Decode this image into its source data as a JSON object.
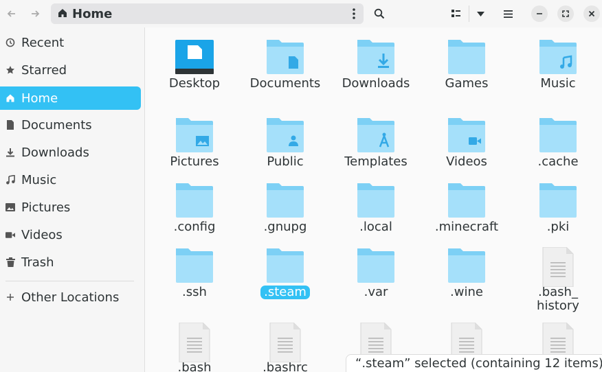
{
  "header": {
    "location_title": "Home"
  },
  "sidebar": {
    "items": [
      {
        "label": "Recent",
        "icon": "clock-icon"
      },
      {
        "label": "Starred",
        "icon": "star-icon"
      },
      {
        "label": "Home",
        "icon": "home-icon",
        "active": true
      },
      {
        "label": "Documents",
        "icon": "document-icon"
      },
      {
        "label": "Downloads",
        "icon": "download-icon"
      },
      {
        "label": "Music",
        "icon": "music-icon"
      },
      {
        "label": "Pictures",
        "icon": "picture-icon"
      },
      {
        "label": "Videos",
        "icon": "video-icon"
      },
      {
        "label": "Trash",
        "icon": "trash-icon"
      }
    ],
    "other_locations": "Other Locations"
  },
  "files": [
    {
      "label": "Desktop",
      "type": "desktop"
    },
    {
      "label": "Documents",
      "type": "folder-documents"
    },
    {
      "label": "Downloads",
      "type": "folder-downloads"
    },
    {
      "label": "Games",
      "type": "folder"
    },
    {
      "label": "Music",
      "type": "folder-music"
    },
    {
      "label": "Pictures",
      "type": "folder-pictures"
    },
    {
      "label": "Public",
      "type": "folder-public"
    },
    {
      "label": "Templates",
      "type": "folder-templates"
    },
    {
      "label": "Videos",
      "type": "folder-videos"
    },
    {
      "label": ".cache",
      "type": "folder"
    },
    {
      "label": ".config",
      "type": "folder"
    },
    {
      "label": ".gnupg",
      "type": "folder"
    },
    {
      "label": ".local",
      "type": "folder"
    },
    {
      "label": ".minecraft",
      "type": "folder"
    },
    {
      "label": ".pki",
      "type": "folder"
    },
    {
      "label": ".ssh",
      "type": "folder"
    },
    {
      "label": ".steam",
      "type": "folder",
      "selected": true
    },
    {
      "label": ".var",
      "type": "folder"
    },
    {
      "label": ".wine",
      "type": "folder"
    },
    {
      "label": ".bash_\nhistory",
      "type": "text-file"
    },
    {
      "label": ".bash",
      "type": "text-file"
    },
    {
      "label": ".bashrc",
      "type": "text-file"
    },
    {
      "label": "",
      "type": "text-file"
    },
    {
      "label": "",
      "type": "text-file"
    },
    {
      "label": "",
      "type": "text-file"
    }
  ],
  "status": "“.steam” selected  (containing 12 items)",
  "colors": {
    "accent": "#33c1f4",
    "folder_back": "#7dd0f5",
    "folder_front": "#a5e0fa",
    "folder_emblem": "#33a9e6"
  }
}
